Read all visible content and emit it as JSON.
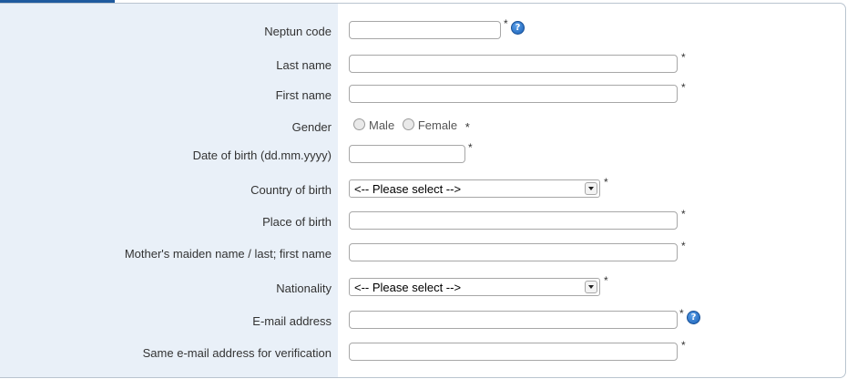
{
  "form": {
    "rows": [
      {
        "label": "Neptun code"
      },
      {
        "label": "Last name"
      },
      {
        "label": "First name"
      },
      {
        "label": "Gender"
      },
      {
        "label": "Date of birth (dd.mm.yyyy)"
      },
      {
        "label": "Country of birth"
      },
      {
        "label": "Place of birth"
      },
      {
        "label": "Mother's maiden name / last; first name"
      },
      {
        "label": "Nationality"
      },
      {
        "label": "E-mail address"
      },
      {
        "label": "Same e-mail address for verification"
      }
    ],
    "required_mark": "*",
    "help_glyph": "?",
    "gender_options": [
      "Male",
      "Female"
    ],
    "country_of_birth_selected": "<-- Please select -->",
    "nationality_selected": "<-- Please select -->",
    "field_values": {
      "neptun_code": "",
      "last_name": "",
      "first_name": "",
      "date_of_birth": "",
      "place_of_birth": "",
      "mothers_maiden_name": "",
      "email": "",
      "email_verification": ""
    },
    "accent_color": "#1f5a9e",
    "label_column_color": "#e9f0f8",
    "icons": {
      "help": "question-circle-icon"
    }
  }
}
